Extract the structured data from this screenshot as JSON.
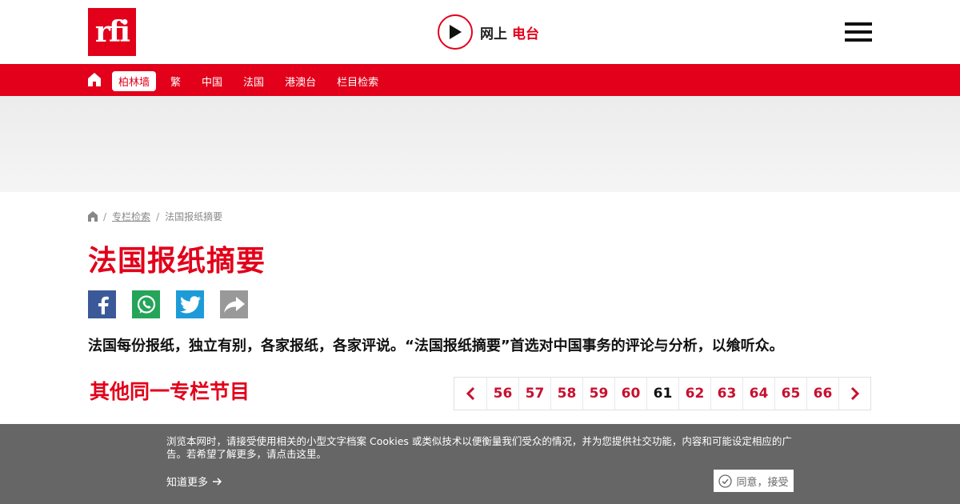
{
  "brand": {
    "logo_text": "rfi",
    "color": "#e2001a"
  },
  "header": {
    "radio_label_part1": "网上",
    "radio_label_part2": "电台"
  },
  "nav": {
    "items": [
      {
        "label": "柏林墙",
        "active": true
      },
      {
        "label": "繁"
      },
      {
        "label": "中国"
      },
      {
        "label": "法国"
      },
      {
        "label": "港澳台"
      },
      {
        "label": "栏目检索"
      }
    ]
  },
  "breadcrumb": {
    "link": "专栏检索",
    "current": "法国报纸摘要"
  },
  "page": {
    "title": "法国报纸摘要",
    "description": "法国每份报纸，独立有别，各家报纸，各家评说。“法国报纸摘要”首选对中国事务的评论与分析，以飨听众。",
    "other_title": "其他同一专栏节目"
  },
  "share": [
    "facebook-icon",
    "whatsapp-icon",
    "twitter-icon",
    "share-icon"
  ],
  "pagination": {
    "pages": [
      "56",
      "57",
      "58",
      "59",
      "60",
      "61",
      "62",
      "63",
      "64",
      "65",
      "66"
    ],
    "current": "61"
  },
  "cookie": {
    "text": "浏览本网时，请接受使用相关的小型文字档案 Cookies 或类似技术以便衡量我们受众的情况，并为您提供社交功能，内容和可能设定相应的广告。若希望了解更多，请点击这里。",
    "more_label": "知道更多",
    "accept_label": "同意，接受"
  }
}
